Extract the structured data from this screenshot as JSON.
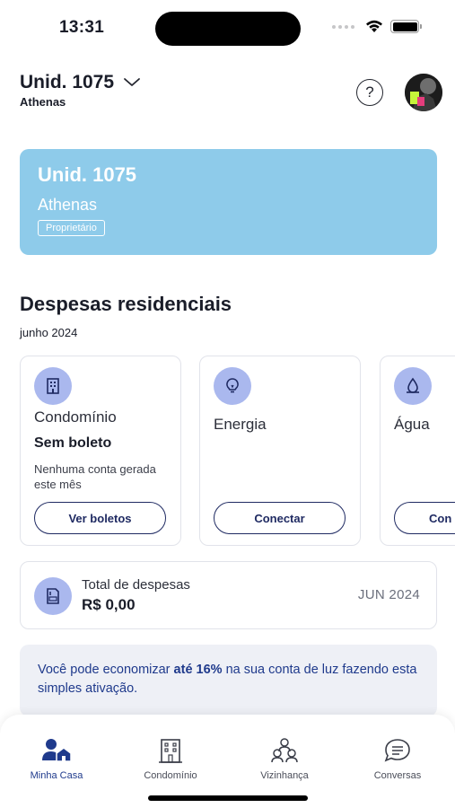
{
  "status_bar": {
    "time": "13:31"
  },
  "header": {
    "unit_title": "Unid. 1075",
    "unit_subtitle": "Athenas",
    "help_icon": "question-circle-icon",
    "avatar_icon": "user-avatar"
  },
  "unit_card": {
    "title": "Unid. 1075",
    "subtitle": "Athenas",
    "role": "Proprietário",
    "background": "#8ecbea"
  },
  "expenses": {
    "title": "Despesas residenciais",
    "date": "junho 2024",
    "cards": [
      {
        "icon": "building-icon",
        "name": "Condomínio",
        "status": "Sem boleto",
        "note": "Nenhuma conta gerada este mês",
        "button": "Ver boletos"
      },
      {
        "icon": "lightbulb-icon",
        "name": "Energia",
        "button": "Conectar"
      },
      {
        "icon": "water-drop-icon",
        "name": "Água",
        "button": "Con"
      }
    ]
  },
  "total": {
    "icon": "invoice-icon",
    "label": "Total de despesas",
    "value": "R$ 0,00",
    "month": "JUN 2024"
  },
  "savings_banner": {
    "prefix": "Você pode economizar ",
    "highlight": "até 16%",
    "suffix": " na sua conta de luz fazendo esta simples ativação."
  },
  "bottom_nav": {
    "items": [
      {
        "label": "Minha Casa",
        "icon": "home-person-icon",
        "active": true
      },
      {
        "label": "Condomínio",
        "icon": "building-icon",
        "active": false
      },
      {
        "label": "Vizinhança",
        "icon": "neighbors-icon",
        "active": false
      },
      {
        "label": "Conversas",
        "icon": "chat-icon",
        "active": false
      }
    ]
  },
  "colors": {
    "accent": "#1f3a8c",
    "icon_bg": "#aab8ee",
    "button_border": "#1f2a62",
    "banner_bg": "#eef0f6"
  }
}
